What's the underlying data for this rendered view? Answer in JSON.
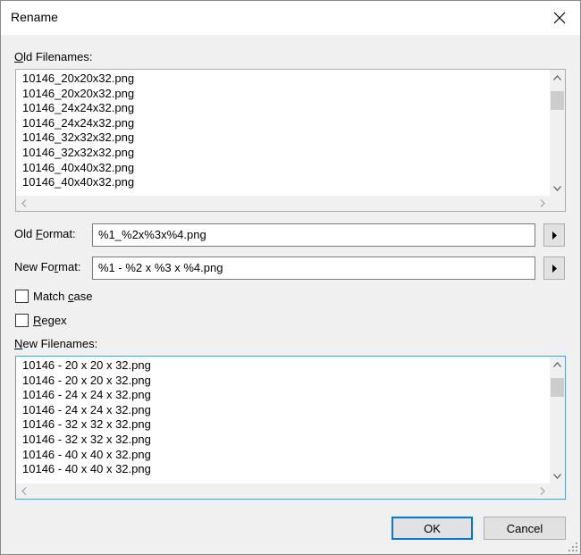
{
  "window": {
    "title": "Rename"
  },
  "old_filenames": {
    "label_mnemonic": "O",
    "label_rest": "ld Filenames:",
    "items": [
      "10146_20x20x32.png",
      "10146_20x20x32.png",
      "10146_24x24x32.png",
      "10146_24x24x32.png",
      "10146_32x32x32.png",
      "10146_32x32x32.png",
      "10146_40x40x32.png",
      "10146_40x40x32.png"
    ]
  },
  "old_format": {
    "label_pre": "Old ",
    "label_mnemonic": "F",
    "label_rest": "ormat:",
    "value": "%1_%2x%3x%4.png"
  },
  "new_format": {
    "label_pre": "New Fo",
    "label_mnemonic": "r",
    "label_rest": "mat:",
    "value": "%1 - %2 x %3 x %4.png"
  },
  "match_case": {
    "label_pre": "Match ",
    "label_mnemonic": "c",
    "label_rest": "ase",
    "checked": false
  },
  "regex": {
    "label_mnemonic": "R",
    "label_rest": "egex",
    "checked": false
  },
  "new_filenames": {
    "label_mnemonic": "N",
    "label_rest": "ew Filenames:",
    "items": [
      "10146 - 20 x 20 x 32.png",
      "10146 - 20 x 20 x 32.png",
      "10146 - 24 x 24 x 32.png",
      "10146 - 24 x 24 x 32.png",
      "10146 - 32 x 32 x 32.png",
      "10146 - 32 x 32 x 32.png",
      "10146 - 40 x 40 x 32.png",
      "10146 - 40 x 40 x 32.png"
    ]
  },
  "buttons": {
    "ok": "OK",
    "cancel": "Cancel"
  },
  "icons": {
    "close": "close-icon",
    "scroll_up": "chevron-up-icon",
    "scroll_down": "chevron-down-icon",
    "scroll_left": "chevron-left-icon",
    "scroll_right": "chevron-right-icon",
    "menu_arrow": "triangle-right-icon",
    "grip": "resize-grip-icon"
  },
  "colors": {
    "accent": "#0078d7",
    "focus_border": "#5b9bd5"
  }
}
